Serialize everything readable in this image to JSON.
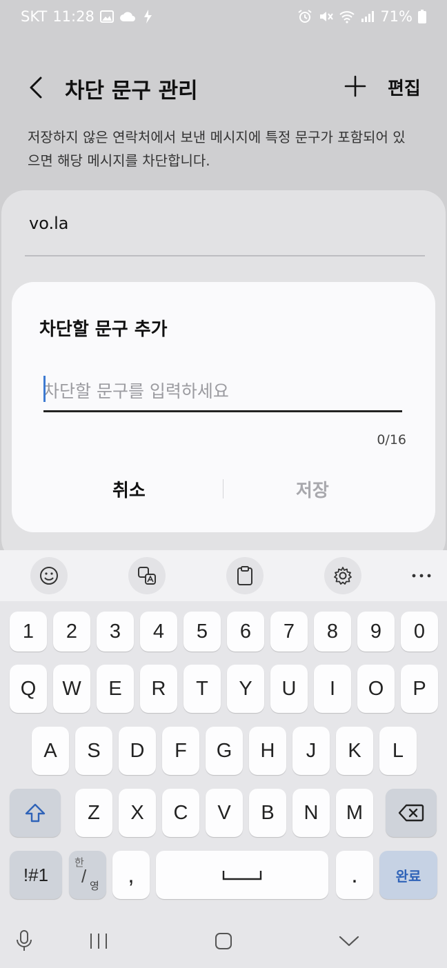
{
  "status_bar": {
    "carrier": "SKT",
    "time": "11:28",
    "battery": "71%",
    "left_icons": [
      "gallery-icon",
      "cloud-icon",
      "bixby-icon"
    ],
    "right_icons": [
      "alarm-icon",
      "mute-icon",
      "wifi-icon",
      "signal-icon",
      "battery-icon"
    ]
  },
  "header": {
    "title": "차단 문구 관리",
    "edit_label": "편집"
  },
  "description": "저장하지 않은 연락처에서 보낸 메시지에 특정 문구가 포함되어 있으면 해당 메시지를 차단합니다.",
  "list": {
    "items": [
      "vo.la"
    ]
  },
  "dialog": {
    "title": "차단할 문구 추가",
    "input_value": "",
    "input_placeholder": "차단할 문구를 입력하세요",
    "char_count": "0/16",
    "cancel_label": "취소",
    "save_label": "저장"
  },
  "keyboard": {
    "toolbar_icons": [
      "emoji-icon",
      "translate-icon",
      "clipboard-icon",
      "settings-icon",
      "more-icon"
    ],
    "row_numbers": [
      "1",
      "2",
      "3",
      "4",
      "5",
      "6",
      "7",
      "8",
      "9",
      "0"
    ],
    "row_1": [
      "Q",
      "W",
      "E",
      "R",
      "T",
      "Y",
      "U",
      "I",
      "O",
      "P"
    ],
    "row_2": [
      "A",
      "S",
      "D",
      "F",
      "G",
      "H",
      "J",
      "K",
      "L"
    ],
    "row_3": [
      "Z",
      "X",
      "C",
      "V",
      "B",
      "N",
      "M"
    ],
    "symbol_label": "!#1",
    "lang_top": "한",
    "lang_bottom": "영",
    "comma": ",",
    "period": ".",
    "done_label": "완료",
    "accent_color": "#2f63b8"
  },
  "nav_bar": {
    "icons": [
      "mic-icon",
      "recent-apps-icon",
      "home-icon",
      "back-nav-icon"
    ]
  }
}
